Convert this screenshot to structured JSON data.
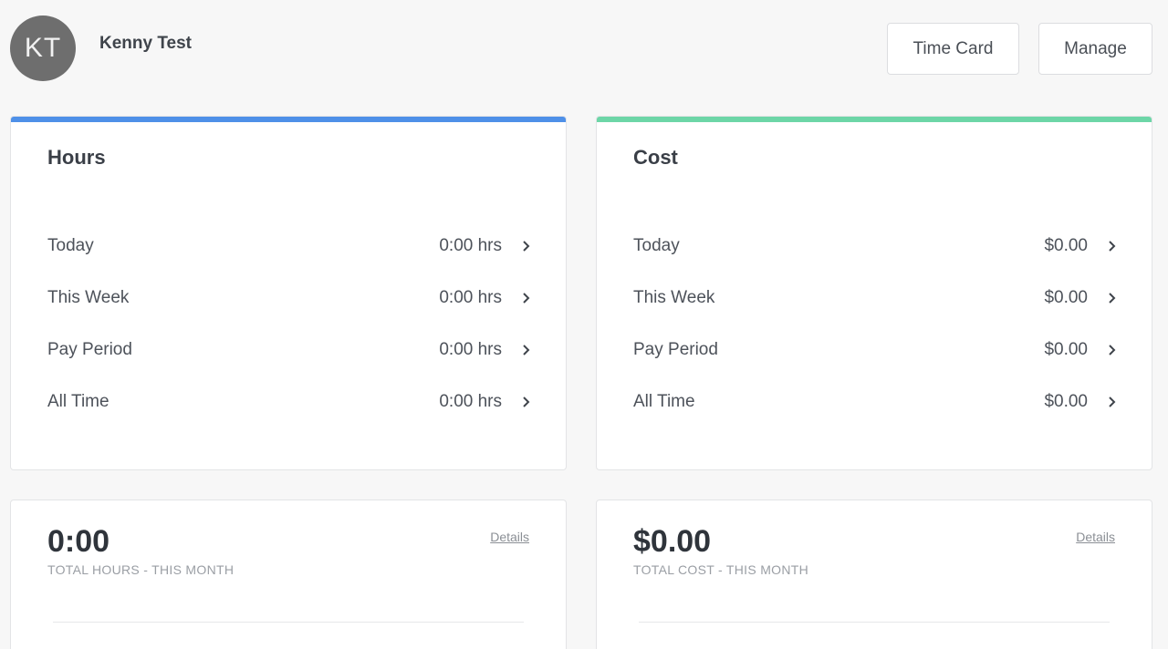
{
  "user": {
    "initials": "KT",
    "name": "Kenny Test"
  },
  "header": {
    "time_card_label": "Time Card",
    "manage_label": "Manage"
  },
  "hours": {
    "title": "Hours",
    "accent_color": "#4e90e8",
    "rows": [
      {
        "label": "Today",
        "value": "0:00 hrs"
      },
      {
        "label": "This Week",
        "value": "0:00 hrs"
      },
      {
        "label": "Pay Period",
        "value": "0:00 hrs"
      },
      {
        "label": "All Time",
        "value": "0:00 hrs"
      }
    ]
  },
  "cost": {
    "title": "Cost",
    "accent_color": "#6dd6a7",
    "rows": [
      {
        "label": "Today",
        "value": "$0.00"
      },
      {
        "label": "This Week",
        "value": "$0.00"
      },
      {
        "label": "Pay Period",
        "value": "$0.00"
      },
      {
        "label": "All Time",
        "value": "$0.00"
      }
    ]
  },
  "monthly_hours": {
    "value": "0:00",
    "label": "TOTAL HOURS - THIS MONTH",
    "details_label": "Details"
  },
  "monthly_cost": {
    "value": "$0.00",
    "label": "TOTAL COST - THIS MONTH",
    "details_label": "Details"
  },
  "icons": {
    "row_chevron": "chevron-right-icon"
  }
}
